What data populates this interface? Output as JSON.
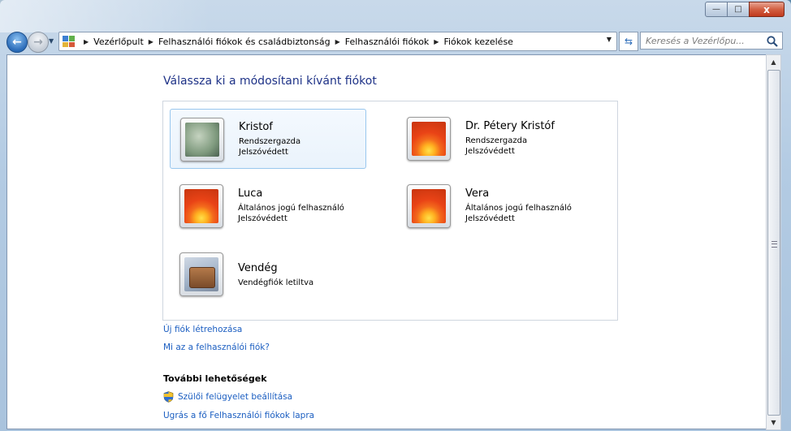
{
  "window": {
    "caption_buttons": {
      "minimize": "—",
      "maximize": "□",
      "close": "x"
    }
  },
  "nav": {
    "back_icon": "back-arrow-icon",
    "forward_icon": "forward-arrow-icon",
    "breadcrumbs": [
      "Vezérlőpult",
      "Felhasználói fiókok és családbiztonság",
      "Felhasználói fiókok",
      "Fiókok kezelése"
    ],
    "search_placeholder": "Keresés a Vezérlőpu..."
  },
  "main": {
    "heading": "Válassza ki a módosítani kívánt fiókot",
    "accounts": [
      {
        "name": "Kristof",
        "role": "Rendszergazda",
        "status": "Jelszóvédett",
        "picture": "frost-picture",
        "selected": true
      },
      {
        "name": "Dr. Pétery Kristóf",
        "role": "Rendszergazda",
        "status": "Jelszóvédett",
        "picture": "flower-picture",
        "selected": false
      },
      {
        "name": "Luca",
        "role": "Általános jogú felhasználó",
        "status": "Jelszóvédett",
        "picture": "flower-picture",
        "selected": false
      },
      {
        "name": "Vera",
        "role": "Általános jogú felhasználó",
        "status": "Jelszóvédett",
        "picture": "flower-picture",
        "selected": false
      },
      {
        "name": "Vendég",
        "role": "Vendégfiók letiltva",
        "status": "",
        "picture": "suitcase-picture",
        "selected": false
      }
    ],
    "links": {
      "create": "Új fiók létrehozása",
      "what_is": "Mi az a felhasználói fiók?"
    },
    "more": {
      "heading": "További lehetőségek",
      "parental": "Szülői felügyelet beállítása",
      "goto_main": "Ugrás a fő Felhasználói fiókok lapra"
    }
  },
  "colors": {
    "link": "#1b5ec1",
    "heading": "#1e3287",
    "close_button": "#c13b1e"
  }
}
